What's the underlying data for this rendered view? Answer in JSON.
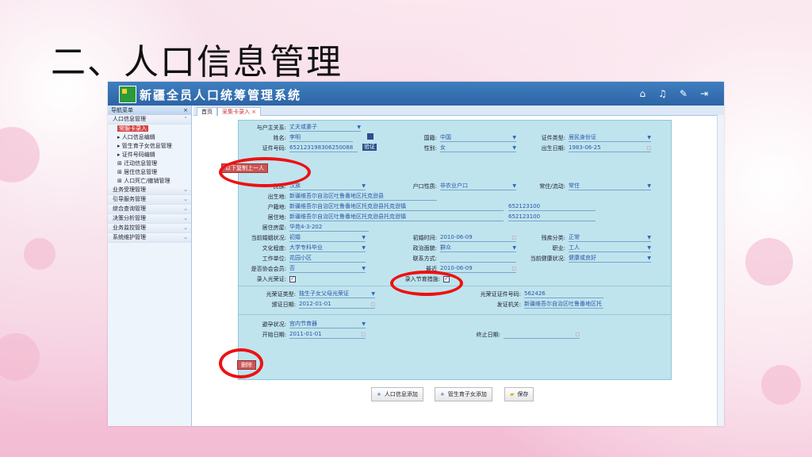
{
  "slide": {
    "title": "二、人口信息管理"
  },
  "app": {
    "title": "新疆全员人口统筹管理系统",
    "top_icons": [
      "home-icon",
      "bell-icon",
      "wrench-icon",
      "exit-icon"
    ]
  },
  "sidebar": {
    "header": "导航菜单",
    "sections": [
      {
        "label": "人口信息管理"
      },
      {
        "label": "业务受理管理"
      },
      {
        "label": "引导服务管理"
      },
      {
        "label": "综合查询管理"
      },
      {
        "label": "决策分析管理"
      },
      {
        "label": "业务监控管理"
      },
      {
        "label": "系统维护管理"
      }
    ],
    "sub_items": [
      "常服卡录入",
      "人口信息编辑",
      "管生育子女信息管理",
      "证件号码编辑",
      "迁动信息管理",
      "居住信息管理",
      "人口死亡/撤销管理"
    ]
  },
  "tabs": [
    {
      "label": "首页"
    },
    {
      "label": "采集卡录入"
    }
  ],
  "form": {
    "relation_label": "与户主关系:",
    "relation_value": "丈夫或妻子",
    "name_label": "姓名:",
    "name_value": "李明",
    "nationality_label": "国籍:",
    "nationality_value": "中国",
    "idtype_label": "证件类型:",
    "idtype_value": "居民身份证",
    "idno_label": "证件号码:",
    "idno_value": "652123198306250088",
    "idno_button": "验证",
    "gender_label": "性别:",
    "gender_value": "女",
    "birth_label": "出生日期:",
    "birth_value": "1983-06-25",
    "copy_button": "以下复制上一人",
    "ethnic_label": "民族:",
    "ethnic_value": "汉族",
    "hukou_label": "户口性质:",
    "hukou_value": "非农业户口",
    "residence_label": "常住/流动:",
    "residence_value": "常住",
    "birthplace_label": "出生地:",
    "birthplace_value": "新疆维吾尔自治区吐鲁番地区托克逊县",
    "domicile_label": "户籍地:",
    "domicile_value": "新疆维吾尔自治区吐鲁番地区托克逊县托克逊镇",
    "domicile_code": "652123100",
    "live_label": "居住地:",
    "live_value": "新疆维吾尔自治区吐鲁番地区托克逊县托克逊镇",
    "live_code": "652123100",
    "house_label": "居住房屋:",
    "house_value": "华苑4-3-202",
    "marital_label": "当前婚姻状况:",
    "marital_value": "初婚",
    "marry_date_label": "初婚时间:",
    "marry_date_value": "2010-06-09",
    "disability_label": "残疾分类:",
    "disability_value": "正常",
    "edu_label": "文化程度:",
    "edu_value": "大学专科毕业",
    "politic_label": "政治面貌:",
    "politic_value": "群众",
    "job_label": "职业:",
    "job_value": "工人",
    "work_label": "工作单位:",
    "work_value": "花园小区",
    "contact_label": "联系方式:",
    "contact_value": "",
    "health_label": "当前健康状况:",
    "health_value": "健康或良好",
    "assoc_label": "是否协会会员:",
    "assoc_value": "否",
    "assoc_date_label": "最近",
    "assoc_date_value": "2010-06-09",
    "honor_label": "录入光荣证:",
    "honor_checked": "✓",
    "plan_label": "录入节育措施:",
    "plan_checked": "✓",
    "honor_type_label": "光荣证类型:",
    "honor_type_value": "独生子女父母光荣证",
    "honor_no_label": "光荣证证件号码:",
    "honor_no_value": "562426",
    "issue_date_label": "颁证日期:",
    "issue_date_value": "2012-01-01",
    "issue_org_label": "发证机关:",
    "issue_org_value": "新疆维吾尔自治区吐鲁番地区托",
    "contra_label": "避孕状况:",
    "contra_value": "宫内节育器",
    "start_label": "开始日期:",
    "start_value": "2011-01-01",
    "end_label": "终止日期:",
    "end_value": "",
    "delete_button": "删除"
  },
  "footer": {
    "add_person": "人口信息添加",
    "add_child": "管生育子女添加",
    "save": "保存"
  }
}
